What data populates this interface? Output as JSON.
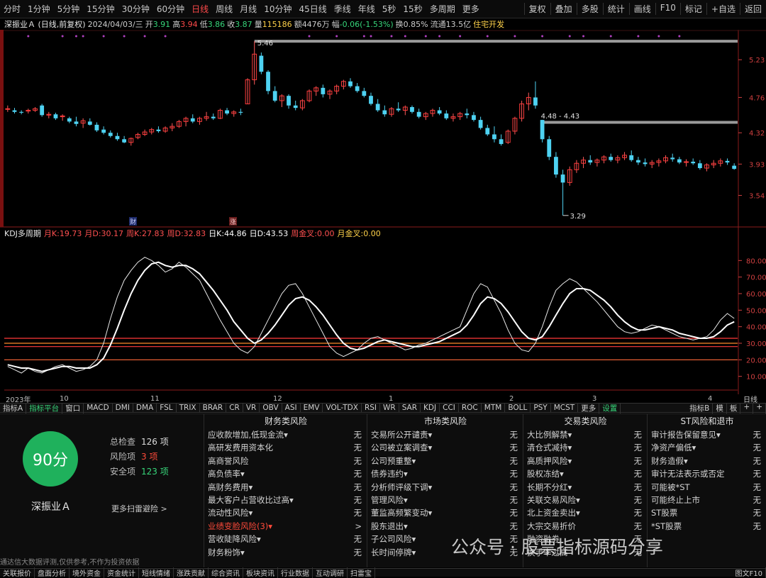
{
  "toolbar": {
    "periods": [
      "分时",
      "1分钟",
      "5分钟",
      "15分钟",
      "30分钟",
      "60分钟",
      "日线",
      "周线",
      "月线",
      "10分钟",
      "45日线",
      "季线",
      "年线",
      "5秒",
      "15秒",
      "多周期",
      "更多"
    ],
    "active_period": "日线",
    "right_buttons": [
      "复权",
      "叠加",
      "多股",
      "统计",
      "画线",
      "F10",
      "标记",
      "+自选",
      "返回"
    ]
  },
  "info": {
    "name": "深振业Ａ (日线,前复权)",
    "date": "2024/04/03/三",
    "open_label": "开",
    "open": "3.91",
    "high_label": "高",
    "high": "3.94",
    "low_label": "低",
    "low": "3.86",
    "close_label": "收",
    "close": "3.87",
    "vol_label": "量",
    "vol": "115186",
    "amount_label": "额",
    "amount": "4476万",
    "change_label": "幅",
    "change": "-0.06(-1.53%)",
    "turnover_label": "换",
    "turnover": "0.85%",
    "float_label": "流通",
    "float": "13.5亿",
    "concept": "住宅开发"
  },
  "price_axis": [
    "5.23",
    "4.76",
    "4.32",
    "3.93",
    "3.54"
  ],
  "price_annotations": {
    "high": "5.46",
    "low": "3.29",
    "gap": "4.48 - 4.43"
  },
  "event_markers": {
    "finance": "财",
    "rise": "涨"
  },
  "kdj": {
    "title": "KDJ多周期",
    "items": [
      {
        "label": "月K:",
        "value": "19.73",
        "color": "#ff5050"
      },
      {
        "label": "月D:",
        "value": "30.17",
        "color": "#ff5050"
      },
      {
        "label": "周K:",
        "value": "27.83",
        "color": "#ff5050"
      },
      {
        "label": "周D:",
        "value": "32.83",
        "color": "#ff5050"
      },
      {
        "label": "日K:",
        "value": "44.86",
        "color": "#ffffff"
      },
      {
        "label": "日D:",
        "value": "43.53",
        "color": "#ffffff"
      },
      {
        "label": "周金叉:",
        "value": "0.00",
        "color": "#ff5050"
      },
      {
        "label": "月金叉:",
        "value": "0.00",
        "color": "#ffd24a"
      }
    ],
    "axis": [
      "80.00",
      "70.00",
      "60.00",
      "50.00",
      "40.00",
      "30.00",
      "20.00",
      "10.00"
    ]
  },
  "time_axis": {
    "labels": [
      "2023年",
      "10",
      "11",
      "12",
      "1",
      "2",
      "3",
      "4"
    ],
    "right": "日线"
  },
  "indicator_tabs": [
    "指标A",
    "指标平台",
    "窗口",
    "MACD",
    "DMI",
    "DMA",
    "FSL",
    "TRIX",
    "BRAR",
    "CR",
    "VR",
    "OBV",
    "ASI",
    "EMV",
    "VOL-TDX",
    "RSI",
    "WR",
    "SAR",
    "KDJ",
    "CCI",
    "ROC",
    "MTM",
    "BOLL",
    "PSY",
    "MCST",
    "更多",
    "设置"
  ],
  "indicator_right": [
    "指标B",
    "模",
    "板",
    "+",
    "+"
  ],
  "risk": {
    "score": "90分",
    "stock_name": "深振业Ａ",
    "total_label": "总检查",
    "total": "126 项",
    "risk_label": "风险项",
    "risk_count": "3 项",
    "safe_label": "安全项",
    "safe": "123 项",
    "more": "更多扫雷避险 >",
    "columns": [
      {
        "title": "财务类风险",
        "rows": [
          {
            "label": "应收款增加,低现金流▾",
            "status": "无",
            "warn": false
          },
          {
            "label": "高研发费用资本化",
            "status": "无",
            "warn": false
          },
          {
            "label": "高商誉风险",
            "status": "无",
            "warn": false
          },
          {
            "label": "高负债率▾",
            "status": "无",
            "warn": false
          },
          {
            "label": "高财务费用▾",
            "status": "无",
            "warn": false
          },
          {
            "label": "最大客户占营收比过高▾",
            "status": "无",
            "warn": false
          },
          {
            "label": "流动性风险▾",
            "status": "无",
            "warn": false
          },
          {
            "label": "业绩变脸风险(3)▾",
            "status": ">",
            "warn": true
          },
          {
            "label": "营收陡降风险▾",
            "status": "无",
            "warn": false
          },
          {
            "label": "财务粉饰▾",
            "status": "无",
            "warn": false
          }
        ]
      },
      {
        "title": "市场类风险",
        "rows": [
          {
            "label": "交易所公开谴责▾",
            "status": "无",
            "warn": false
          },
          {
            "label": "公司被立案调查▾",
            "status": "无",
            "warn": false
          },
          {
            "label": "公司预重整▾",
            "status": "无",
            "warn": false
          },
          {
            "label": "债券违约▾",
            "status": "无",
            "warn": false
          },
          {
            "label": "分析师评级下调▾",
            "status": "无",
            "warn": false
          },
          {
            "label": "管理风险▾",
            "status": "无",
            "warn": false
          },
          {
            "label": "董监高频繁变动▾",
            "status": "无",
            "warn": false
          },
          {
            "label": "股东退出▾",
            "status": "无",
            "warn": false
          },
          {
            "label": "子公司风险▾",
            "status": "无",
            "warn": false
          },
          {
            "label": "长时间停牌▾",
            "status": "无",
            "warn": false
          }
        ]
      },
      {
        "title": "交易类风险",
        "rows": [
          {
            "label": "大比例解禁▾",
            "status": "无",
            "warn": false
          },
          {
            "label": "清仓式减持▾",
            "status": "无",
            "warn": false
          },
          {
            "label": "高质押风险▾",
            "status": "无",
            "warn": false
          },
          {
            "label": "股权冻结▾",
            "status": "无",
            "warn": false
          },
          {
            "label": "长期不分红▾",
            "status": "无",
            "warn": false
          },
          {
            "label": "关联交易风险▾",
            "status": "无",
            "warn": false
          },
          {
            "label": "北上资金卖出▾",
            "status": "无",
            "warn": false
          },
          {
            "label": "大宗交易折价",
            "status": "无",
            "warn": false
          },
          {
            "label": "融资融券",
            "status": "无",
            "warn": false
          },
          {
            "label": "换手率过高",
            "status": "无",
            "warn": false
          }
        ]
      },
      {
        "title": "ST风险和退市",
        "rows": [
          {
            "label": "审计报告保留意见▾",
            "status": "无",
            "warn": false
          },
          {
            "label": "净资产偏低▾",
            "status": "无",
            "warn": false
          },
          {
            "label": "财务造假▾",
            "status": "无",
            "warn": false
          },
          {
            "label": "审计无法表示或否定",
            "status": "无",
            "warn": false
          },
          {
            "label": "可能被*ST",
            "status": "无",
            "warn": false
          },
          {
            "label": "可能终止上市",
            "status": "无",
            "warn": false
          },
          {
            "label": "ST股票",
            "status": "无",
            "warn": false
          },
          {
            "label": "*ST股票",
            "status": "无",
            "warn": false
          },
          {
            "label": "",
            "status": "",
            "warn": false
          },
          {
            "label": "",
            "status": "",
            "warn": false
          }
        ]
      }
    ],
    "disclaimer": "通达信大数据评测,仅供参考,不作为投资依据",
    "watermark": "公众号 · 股票指标源码分享"
  },
  "bottom_tabs": [
    "关联报价",
    "盘面分析",
    "境外资金",
    "资金统计",
    "短线情绪",
    "涨跌贡献",
    "综合资讯",
    "板块资讯",
    "行业数据",
    "互动调研",
    "扫雷宝"
  ],
  "bottom_right": "图文F10",
  "chart_data": {
    "type": "candlestick",
    "ohlc": [
      [
        4.62,
        4.66,
        4.58,
        4.62
      ],
      [
        4.6,
        4.63,
        4.56,
        4.58
      ],
      [
        4.58,
        4.6,
        4.55,
        4.57
      ],
      [
        4.59,
        4.62,
        4.56,
        4.6
      ],
      [
        4.6,
        4.64,
        4.58,
        4.62
      ],
      [
        4.66,
        4.68,
        4.52,
        4.54
      ],
      [
        4.54,
        4.58,
        4.5,
        4.55
      ],
      [
        4.55,
        4.57,
        4.48,
        4.5
      ],
      [
        4.52,
        4.55,
        4.47,
        4.53
      ],
      [
        4.5,
        4.52,
        4.44,
        4.46
      ],
      [
        4.46,
        4.52,
        4.4,
        4.43
      ],
      [
        4.44,
        4.5,
        4.38,
        4.47
      ],
      [
        4.46,
        4.5,
        4.41,
        4.42
      ],
      [
        4.42,
        4.45,
        4.33,
        4.35
      ],
      [
        4.36,
        4.4,
        4.3,
        4.32
      ],
      [
        4.32,
        4.35,
        4.26,
        4.28
      ],
      [
        4.28,
        4.32,
        4.22,
        4.24
      ],
      [
        4.24,
        4.28,
        4.19,
        4.2
      ],
      [
        4.2,
        4.26,
        4.16,
        4.25
      ],
      [
        4.26,
        4.32,
        4.24,
        4.3
      ],
      [
        4.3,
        4.36,
        4.28,
        4.33
      ],
      [
        4.33,
        4.38,
        4.3,
        4.36
      ],
      [
        4.36,
        4.4,
        4.32,
        4.34
      ],
      [
        4.34,
        4.4,
        4.32,
        4.38
      ],
      [
        4.38,
        4.44,
        4.34,
        4.4
      ],
      [
        4.4,
        4.48,
        4.38,
        4.46
      ],
      [
        4.46,
        4.52,
        4.4,
        4.5
      ],
      [
        4.5,
        4.55,
        4.44,
        4.46
      ],
      [
        4.46,
        4.52,
        4.42,
        4.5
      ],
      [
        4.5,
        4.58,
        4.47,
        4.52
      ],
      [
        4.52,
        4.56,
        4.48,
        4.5
      ],
      [
        4.5,
        4.62,
        4.49,
        4.6
      ],
      [
        4.6,
        4.63,
        4.54,
        4.56
      ],
      [
        4.56,
        4.6,
        4.52,
        4.58
      ],
      [
        4.58,
        4.62,
        4.54,
        4.57
      ],
      [
        4.68,
        5.0,
        4.68,
        4.98
      ],
      [
        4.98,
        5.46,
        4.92,
        5.3
      ],
      [
        5.28,
        5.32,
        5.05,
        5.08
      ],
      [
        5.08,
        5.1,
        4.8,
        4.84
      ],
      [
        4.84,
        4.9,
        4.7,
        4.72
      ],
      [
        4.72,
        4.8,
        4.64,
        4.78
      ],
      [
        4.78,
        4.8,
        4.62,
        4.66
      ],
      [
        4.66,
        4.72,
        4.6,
        4.63
      ],
      [
        4.63,
        4.74,
        4.6,
        4.72
      ],
      [
        4.72,
        4.86,
        4.7,
        4.84
      ],
      [
        4.84,
        4.9,
        4.78,
        4.88
      ],
      [
        4.88,
        4.92,
        4.76,
        4.8
      ],
      [
        4.8,
        4.86,
        4.74,
        4.84
      ],
      [
        4.84,
        4.92,
        4.8,
        4.9
      ],
      [
        4.9,
        4.98,
        4.86,
        4.96
      ],
      [
        4.96,
        5.0,
        4.88,
        4.9
      ],
      [
        4.9,
        4.94,
        4.82,
        4.84
      ],
      [
        4.84,
        4.88,
        4.76,
        4.78
      ],
      [
        4.78,
        4.82,
        4.66,
        4.68
      ],
      [
        4.68,
        4.74,
        4.58,
        4.6
      ],
      [
        4.6,
        4.66,
        4.52,
        4.55
      ],
      [
        4.55,
        4.64,
        4.52,
        4.62
      ],
      [
        4.62,
        4.7,
        4.58,
        4.6
      ],
      [
        4.6,
        4.66,
        4.54,
        4.64
      ],
      [
        4.64,
        4.66,
        4.56,
        4.58
      ],
      [
        4.58,
        4.62,
        4.5,
        4.52
      ],
      [
        4.52,
        4.58,
        4.48,
        4.56
      ],
      [
        4.56,
        4.62,
        4.52,
        4.6
      ],
      [
        4.6,
        4.64,
        4.54,
        4.56
      ],
      [
        4.56,
        4.6,
        4.48,
        4.5
      ],
      [
        4.5,
        4.56,
        4.46,
        4.52
      ],
      [
        4.52,
        4.58,
        4.48,
        4.56
      ],
      [
        4.56,
        4.62,
        4.5,
        4.54
      ],
      [
        4.54,
        4.58,
        4.46,
        4.48
      ],
      [
        4.48,
        4.52,
        4.36,
        4.38
      ],
      [
        4.38,
        4.42,
        4.28,
        4.3
      ],
      [
        4.3,
        4.4,
        4.2,
        4.24
      ],
      [
        4.24,
        4.3,
        4.16,
        4.18
      ],
      [
        4.2,
        4.36,
        4.18,
        4.34
      ],
      [
        4.34,
        4.52,
        4.3,
        4.5
      ],
      [
        4.5,
        4.72,
        4.46,
        4.68
      ],
      [
        4.68,
        4.82,
        4.6,
        4.76
      ],
      [
        4.76,
        4.96,
        4.62,
        4.66
      ],
      [
        4.48,
        4.48,
        4.2,
        4.24
      ],
      [
        4.24,
        4.28,
        3.98,
        4.02
      ],
      [
        4.02,
        4.08,
        3.76,
        3.8
      ],
      [
        3.8,
        3.86,
        3.29,
        3.7
      ],
      [
        3.7,
        3.9,
        3.66,
        3.86
      ],
      [
        3.86,
        3.98,
        3.82,
        3.94
      ],
      [
        3.94,
        4.02,
        3.88,
        3.98
      ],
      [
        3.98,
        4.04,
        3.92,
        3.95
      ],
      [
        3.95,
        4.0,
        3.9,
        3.98
      ],
      [
        3.98,
        4.04,
        3.94,
        4.02
      ],
      [
        4.02,
        4.06,
        3.96,
        3.98
      ],
      [
        3.98,
        4.04,
        3.94,
        4.01
      ],
      [
        4.01,
        4.08,
        3.98,
        4.04
      ],
      [
        4.04,
        4.1,
        3.96,
        3.98
      ],
      [
        3.98,
        4.02,
        3.92,
        3.95
      ],
      [
        3.95,
        4.0,
        3.9,
        3.93
      ],
      [
        3.93,
        3.98,
        3.88,
        3.95
      ],
      [
        3.95,
        4.0,
        3.9,
        3.97
      ],
      [
        3.97,
        4.04,
        3.94,
        4.01
      ],
      [
        4.01,
        4.06,
        3.96,
        3.99
      ],
      [
        3.99,
        4.02,
        3.93,
        3.95
      ],
      [
        3.95,
        3.99,
        3.9,
        3.96
      ],
      [
        3.96,
        4.0,
        3.92,
        3.94
      ],
      [
        3.94,
        3.98,
        3.86,
        3.88
      ],
      [
        3.88,
        3.94,
        3.84,
        3.92
      ],
      [
        3.92,
        3.98,
        3.88,
        3.94
      ],
      [
        3.94,
        4.0,
        3.9,
        3.97
      ],
      [
        3.97,
        4.0,
        3.92,
        3.95
      ],
      [
        3.91,
        3.94,
        3.86,
        3.87
      ]
    ],
    "kdj_k": [
      16,
      14,
      12,
      15,
      13,
      12,
      14,
      16,
      17,
      15,
      13,
      14,
      16,
      20,
      30,
      45,
      58,
      68,
      74,
      79,
      82,
      80,
      77,
      73,
      75,
      79,
      76,
      72,
      68,
      60,
      52,
      44,
      37,
      30,
      26,
      24,
      28,
      36,
      44,
      52,
      60,
      65,
      66,
      60,
      52,
      44,
      36,
      28,
      24,
      22,
      24,
      26,
      30,
      33,
      34,
      32,
      30,
      28,
      26,
      27,
      29,
      30,
      32,
      34,
      36,
      38,
      40,
      50,
      60,
      66,
      64,
      56,
      48,
      38,
      30,
      26,
      25,
      30,
      40,
      52,
      62,
      66,
      69,
      67,
      63,
      59,
      55,
      50,
      45,
      40,
      37,
      36,
      37,
      39,
      41,
      40,
      38,
      36,
      34,
      33,
      32,
      33,
      34,
      38,
      44,
      48,
      45
    ],
    "kdj_d": [
      17,
      16,
      15,
      15,
      14,
      13,
      14,
      15,
      16,
      16,
      15,
      15,
      15,
      17,
      21,
      29,
      39,
      50,
      60,
      68,
      74,
      78,
      79,
      77,
      76,
      77,
      77,
      75,
      72,
      67,
      62,
      56,
      50,
      43,
      38,
      33,
      30,
      32,
      36,
      41,
      47,
      53,
      57,
      58,
      56,
      52,
      47,
      41,
      35,
      30,
      27,
      26,
      27,
      29,
      31,
      32,
      31,
      30,
      29,
      28,
      28,
      29,
      30,
      31,
      33,
      35,
      37,
      41,
      47,
      54,
      58,
      57,
      54,
      49,
      43,
      37,
      33,
      32,
      34,
      40,
      47,
      54,
      60,
      63,
      63,
      62,
      59,
      56,
      52,
      47,
      43,
      40,
      38,
      38,
      39,
      40,
      39,
      38,
      36,
      35,
      34,
      33,
      33,
      34,
      37,
      41,
      43
    ],
    "price_range": [
      3.2,
      5.55
    ],
    "kdj_range": [
      0,
      90
    ],
    "kdj_reference_lines": [
      33,
      30,
      28,
      20
    ]
  }
}
